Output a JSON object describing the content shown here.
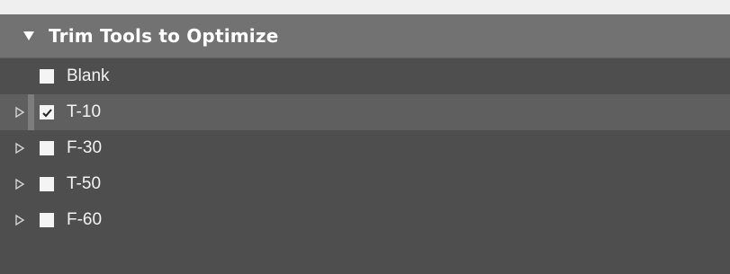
{
  "panel": {
    "title": "Trim Tools to Optimize",
    "header_icon": "triangle-down-icon"
  },
  "items": [
    {
      "label": "Blank",
      "checked": false,
      "expandable": false,
      "selected": false
    },
    {
      "label": "T-10",
      "checked": true,
      "expandable": true,
      "selected": true
    },
    {
      "label": "F-30",
      "checked": false,
      "expandable": true,
      "selected": false
    },
    {
      "label": "T-50",
      "checked": false,
      "expandable": true,
      "selected": false
    },
    {
      "label": "F-60",
      "checked": false,
      "expandable": true,
      "selected": false
    }
  ],
  "colors": {
    "header_bg": "#727272",
    "panel_bg": "#4e4e4e",
    "selected_row_bg": "#5f5f5f",
    "checkbox_bg": "#f4f4f4",
    "text": "#f3f3f3"
  }
}
